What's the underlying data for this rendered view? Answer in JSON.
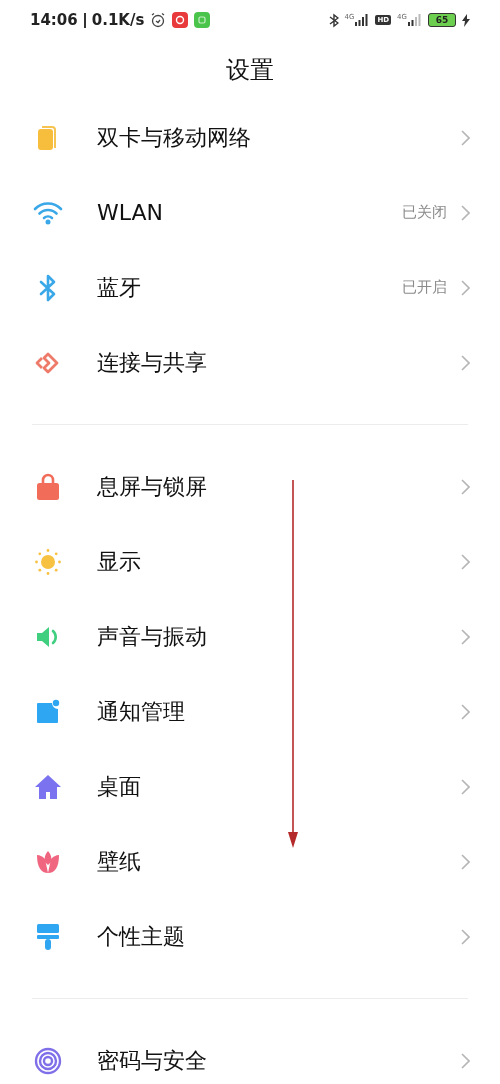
{
  "status_bar": {
    "time": "14:06",
    "speed": "0.1K/s",
    "sim1_type": "4G",
    "hd": "HD",
    "sim2_type": "4G",
    "battery": "65"
  },
  "title": "设置",
  "groups": [
    {
      "items": [
        {
          "label": "双卡与移动网络"
        },
        {
          "label": "WLAN",
          "value": "已关闭"
        },
        {
          "label": "蓝牙",
          "value": "已开启"
        },
        {
          "label": "连接与共享"
        }
      ]
    },
    {
      "items": [
        {
          "label": "息屏与锁屏"
        },
        {
          "label": "显示"
        },
        {
          "label": "声音与振动"
        },
        {
          "label": "通知管理"
        },
        {
          "label": "桌面"
        },
        {
          "label": "壁纸"
        },
        {
          "label": "个性主题"
        }
      ]
    },
    {
      "items": [
        {
          "label": "密码与安全"
        }
      ]
    }
  ]
}
